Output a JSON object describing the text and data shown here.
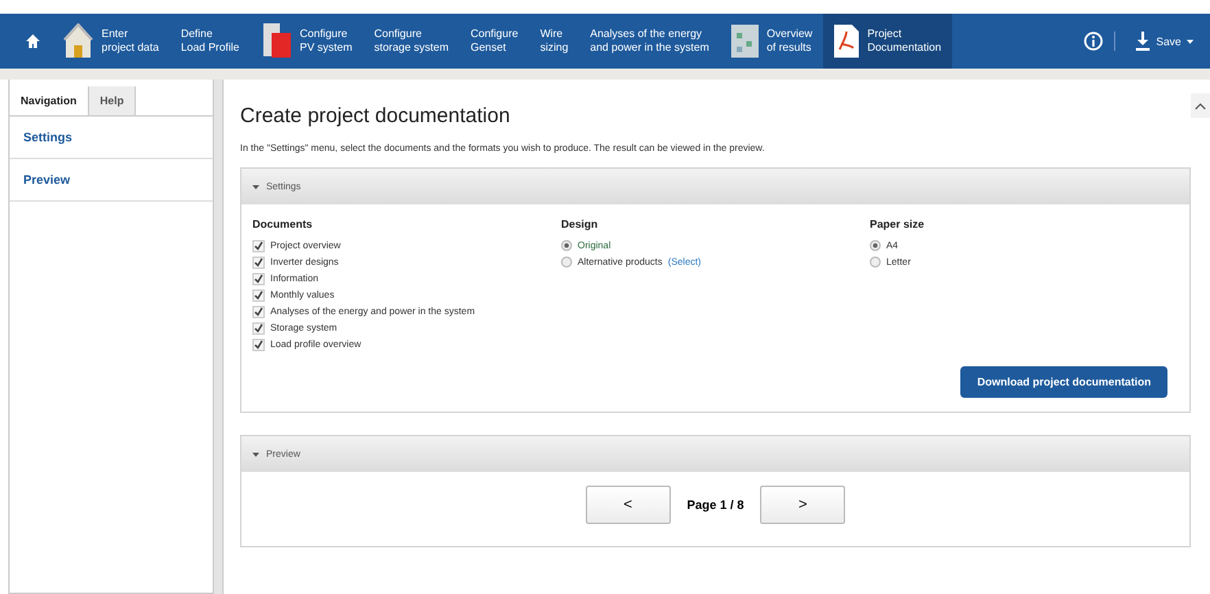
{
  "steps": [
    {
      "kind": "home",
      "selected": false
    },
    {
      "kind": "house",
      "lines": [
        "Enter",
        "project data"
      ],
      "selected": false
    },
    {
      "kind": "none",
      "lines": [
        "Define",
        "Load Profile"
      ],
      "selected": false
    },
    {
      "kind": "inverter",
      "lines": [
        "Configure",
        "PV system"
      ],
      "selected": false
    },
    {
      "kind": "none",
      "lines": [
        "Configure",
        "storage system"
      ],
      "selected": false
    },
    {
      "kind": "none",
      "lines": [
        "Configure",
        "Genset"
      ],
      "selected": false
    },
    {
      "kind": "none",
      "lines": [
        "Wire",
        "sizing"
      ],
      "selected": false
    },
    {
      "kind": "none",
      "lines": [
        "Analyses of the energy",
        "and power in the system"
      ],
      "selected": false
    },
    {
      "kind": "results",
      "lines": [
        "Overview",
        "of results"
      ],
      "selected": false
    },
    {
      "kind": "pdf",
      "lines": [
        "Project",
        "Documentation"
      ],
      "selected": true
    }
  ],
  "save": "Save",
  "sidebar": {
    "tabs": [
      {
        "label": "Navigation",
        "selected": true
      },
      {
        "label": "Help",
        "selected": false
      }
    ],
    "items": [
      "Settings",
      "Preview"
    ]
  },
  "title": "Create project documentation",
  "intro": "In the \"Settings\" menu, select the documents and the formats you wish to produce. The result can be viewed in the preview.",
  "settings": {
    "header": "Settings",
    "documents": {
      "heading": "Documents",
      "items": [
        {
          "label": "Project overview",
          "checked": true
        },
        {
          "label": "Inverter designs",
          "checked": true
        },
        {
          "label": "Information",
          "checked": true
        },
        {
          "label": "Monthly values",
          "checked": true
        },
        {
          "label": "Analyses of the energy and power in the system",
          "checked": true
        },
        {
          "label": "Storage system",
          "checked": true
        },
        {
          "label": "Load profile overview",
          "checked": true
        }
      ]
    },
    "design": {
      "heading": "Design",
      "options": [
        {
          "label": "Original",
          "selected": true
        },
        {
          "label": "Alternative products",
          "link": "(Select)",
          "selected": false
        }
      ]
    },
    "paper": {
      "heading": "Paper size",
      "options": [
        {
          "label": "A4",
          "selected": true
        },
        {
          "label": "Letter",
          "selected": false
        }
      ]
    },
    "download": "Download project documentation"
  },
  "preview": {
    "header": "Preview",
    "prev": "<",
    "page": "Page 1 / 8",
    "next": ">"
  }
}
